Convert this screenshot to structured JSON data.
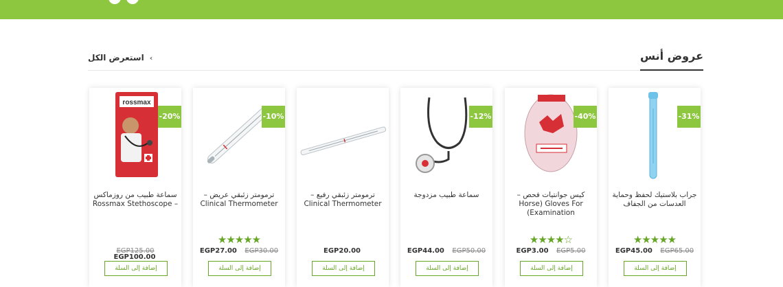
{
  "section": {
    "title": "عروض أنس",
    "view_all": "استعرض الكل"
  },
  "colors": {
    "accent": "#8dc63f",
    "star": "#66a625"
  },
  "products": [
    {
      "name": "جراب بلاستيك لحفظ وحماية العدسات من الجفاف",
      "badge": "-31%",
      "rating": 5,
      "price": "EGP45.00",
      "old_price": "EGP65.00",
      "button": "إضافة إلى السلة",
      "image": "lens-case-image"
    },
    {
      "name": "كيس جوانتيات فحص – Horse) Gloves For (Examination",
      "badge": "-40%",
      "rating": 4,
      "price": "EGP3.00",
      "old_price": "EGP5.00",
      "button": "إضافة إلى السلة",
      "image": "gloves-bag-image"
    },
    {
      "name": "سماعة طبيب مزدوجة",
      "badge": "-12%",
      "rating": 0,
      "price": "EGP44.00",
      "old_price": "EGP50.00",
      "button": "إضافة إلى السلة",
      "image": "stethoscope-image"
    },
    {
      "name": "ترمومتر زئبقي رفيع – Clinical Thermometer",
      "badge": "",
      "rating": 0,
      "price": "EGP20.00",
      "old_price": "",
      "button": "إضافة إلى السلة",
      "image": "thin-thermometer-image"
    },
    {
      "name": "ترمومتر زئبقي عريض – Clinical Thermometer",
      "badge": "-10%",
      "rating": 5,
      "price": "EGP27.00",
      "old_price": "EGP30.00",
      "button": "إضافة إلى السلة",
      "image": "wide-thermometer-image"
    },
    {
      "name": "سماعة طبيب من روزماكس – Rossmax Stethoscope",
      "badge": "-20%",
      "rating": 0,
      "price": "EGP100.00",
      "old_price": "EGP125.00",
      "button": "إضافة إلى السلة",
      "image": "rossmax-box-image",
      "brand": "rossmax"
    }
  ]
}
